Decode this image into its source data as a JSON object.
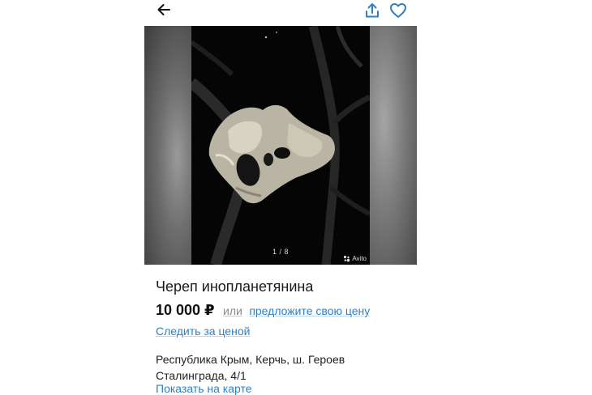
{
  "header": {
    "back_icon": "arrow-left-icon",
    "share_icon": "share-icon",
    "favorite_icon": "heart-outline-icon",
    "icon_color": "#2f7fc1"
  },
  "gallery": {
    "counter": "1 / 8",
    "watermark": "Avito"
  },
  "listing": {
    "title": "Череп инопланетянина",
    "price": "10 000 ₽",
    "or_label": "или",
    "offer_link": "предложите свою цену",
    "follow_price_link": "Следить за ценой",
    "address_line1": "Республика Крым, Керчь, ш. Героев",
    "address_line2": "Сталинграда, 4/1",
    "map_link": "Показать на карте",
    "link_color": "#2f7fc1"
  }
}
